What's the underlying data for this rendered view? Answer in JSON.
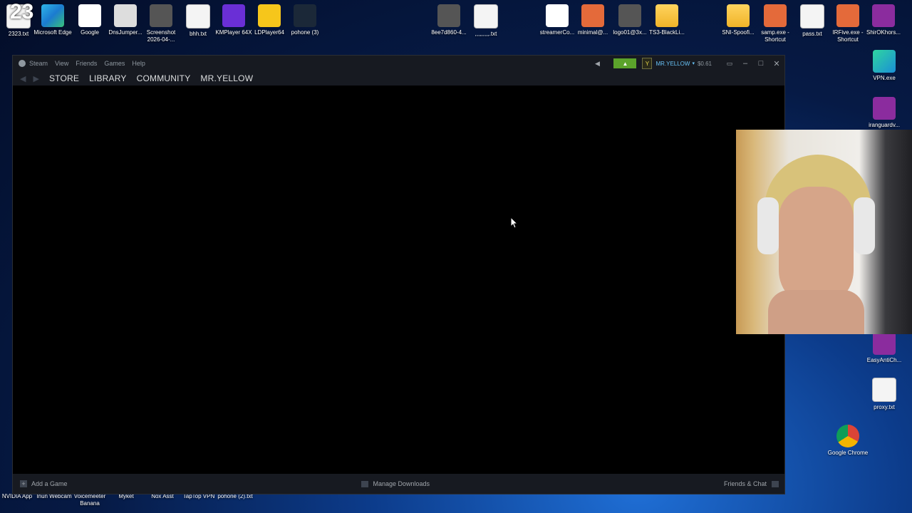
{
  "desktop": {
    "icons_top": [
      {
        "label": "2323.txt",
        "icon": "text-file-icon"
      },
      {
        "label": "Microsoft Edge",
        "icon": "edge-icon"
      },
      {
        "label": "Google",
        "icon": "google-icon"
      },
      {
        "label": "DnsJumper...",
        "icon": "file-icon"
      },
      {
        "label": "Screenshot 2026-04-...",
        "icon": "image-icon"
      },
      {
        "label": "bhh.txt",
        "icon": "text-file-icon"
      },
      {
        "label": "KMPlayer 64X",
        "icon": "kmplayer-icon"
      },
      {
        "label": "LDPlayer64",
        "icon": "ldplayer-icon"
      },
      {
        "label": "pohone (3)",
        "icon": "steam-icon"
      },
      {
        "label": "8ee7d860-4...",
        "icon": "image-icon"
      },
      {
        "label": ",,,,,,,,,.txt",
        "icon": "text-file-icon"
      },
      {
        "label": "streamerCo...",
        "icon": "qr-icon"
      },
      {
        "label": "minimal@...",
        "icon": "app-icon"
      },
      {
        "label": "logo01@3x...",
        "icon": "image-icon"
      },
      {
        "label": "TS3-BlackLi...",
        "icon": "folder-icon"
      },
      {
        "label": "SNI-Spoofi...",
        "icon": "folder-icon"
      },
      {
        "label": "samp.exe - Shortcut",
        "icon": "app-icon"
      },
      {
        "label": "pass.txt",
        "icon": "text-file-icon"
      },
      {
        "label": "IRFive.exe - Shortcut",
        "icon": "app-icon"
      },
      {
        "label": "ShirOKhors...",
        "icon": "winrar-icon"
      }
    ],
    "icons_right": [
      {
        "label": "VPN.exe",
        "icon": "app-icon"
      },
      {
        "label": "iranguardv...",
        "icon": "winrar-icon"
      },
      {
        "label": "EasyAntiCh...",
        "icon": "winrar-icon"
      },
      {
        "label": "proxy.txt",
        "icon": "text-file-icon"
      },
      {
        "label": "Google Chrome",
        "icon": "chrome-icon"
      }
    ],
    "icons_bottom": [
      {
        "label": "NVIDIA App"
      },
      {
        "label": "Inun Webcam"
      },
      {
        "label": "Voicemeeter Banana"
      },
      {
        "label": "Myket"
      },
      {
        "label": "Nox Asst"
      },
      {
        "label": "TapTop VPN"
      },
      {
        "label": "pohone (2).txt"
      }
    ],
    "big_number": "23"
  },
  "steam": {
    "title": "Steam",
    "menu": [
      "View",
      "Friends",
      "Games",
      "Help"
    ],
    "nav": [
      "STORE",
      "LIBRARY",
      "COMMUNITY",
      "MR.YELLOW"
    ],
    "account_name": "MR.YELLOW",
    "avatar_letter": "Y",
    "wallet": "$0.61",
    "footer_add_game": "Add a Game",
    "footer_downloads": "Manage Downloads",
    "footer_friends": "Friends & Chat"
  }
}
